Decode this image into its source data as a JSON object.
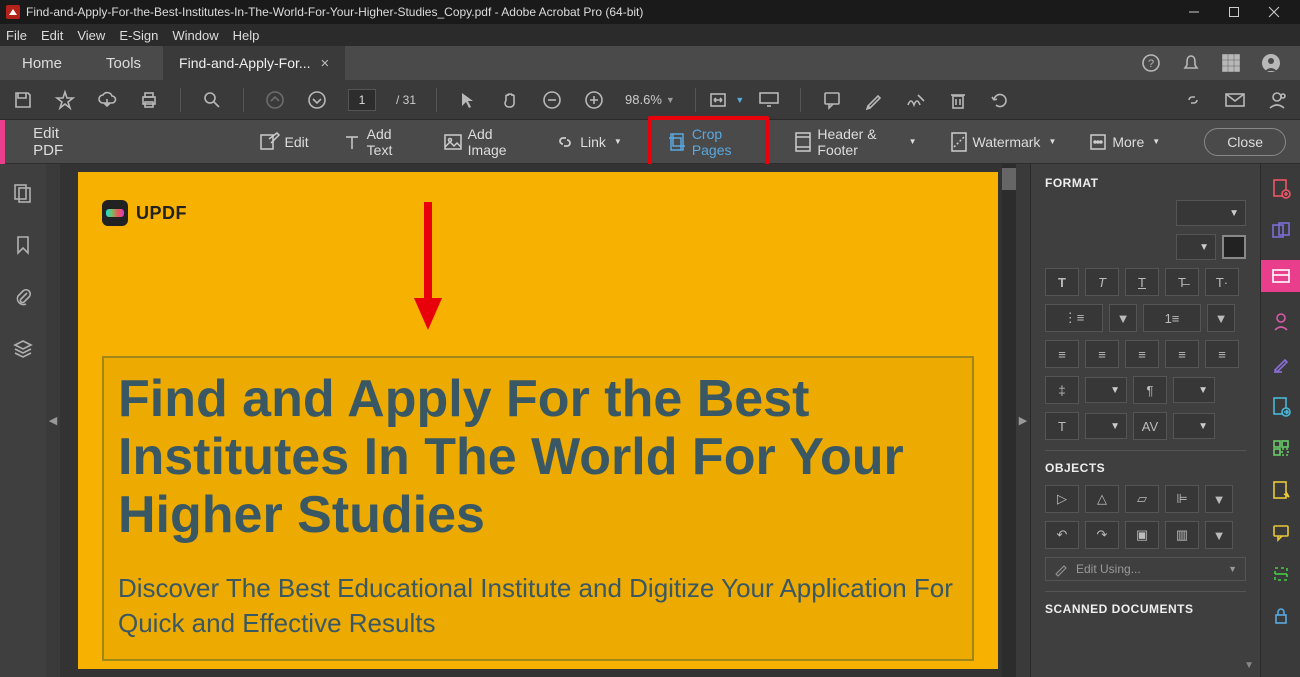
{
  "titlebar": {
    "title": "Find-and-Apply-For-the-Best-Institutes-In-The-World-For-Your-Higher-Studies_Copy.pdf - Adobe Acrobat Pro (64-bit)"
  },
  "menubar": {
    "items": [
      "File",
      "Edit",
      "View",
      "E-Sign",
      "Window",
      "Help"
    ]
  },
  "tabs": {
    "home": "Home",
    "tools": "Tools",
    "doc": "Find-and-Apply-For..."
  },
  "toolbar": {
    "page_current": "1",
    "page_total": "/ 31",
    "zoom": "98.6%"
  },
  "ctxbar": {
    "title": "Edit PDF",
    "edit": "Edit",
    "add_text": "Add Text",
    "add_image": "Add Image",
    "link": "Link",
    "crop_pages": "Crop Pages",
    "header_footer": "Header & Footer",
    "watermark": "Watermark",
    "more": "More",
    "close": "Close"
  },
  "document": {
    "brand": "UPDF",
    "heading": "Find and Apply For the Best Institutes In The World For Your Higher Studies",
    "subheading": "Discover The Best Educational Institute and Digitize Your Application For Quick and Effective Results"
  },
  "format_panel": {
    "format": "FORMAT",
    "objects": "OBJECTS",
    "edit_using": "Edit Using...",
    "scanned": "SCANNED DOCUMENTS",
    "letter_spacing_label": "AV"
  }
}
